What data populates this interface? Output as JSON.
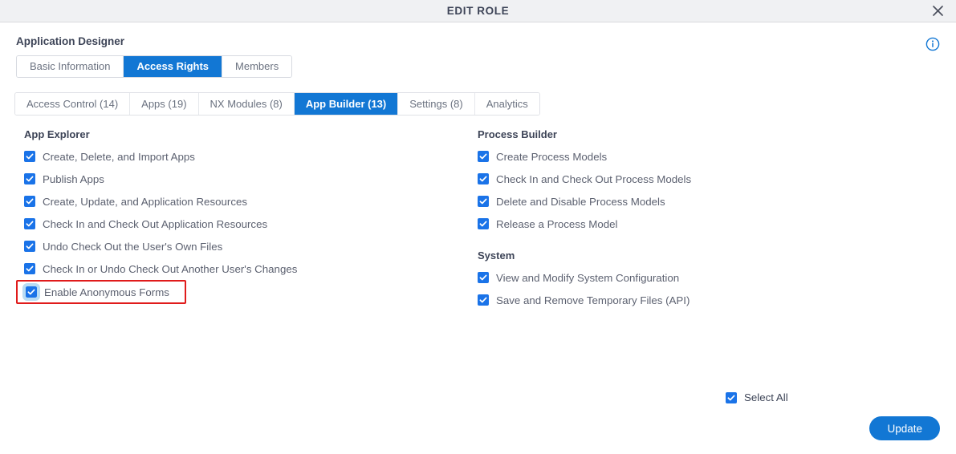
{
  "header": {
    "title": "EDIT ROLE",
    "close_icon": "close-icon"
  },
  "info": {
    "icon": "info-circle-icon"
  },
  "page_title": "Application Designer",
  "primary_tabs": [
    {
      "label": "Basic Information",
      "active": false
    },
    {
      "label": "Access Rights",
      "active": true
    },
    {
      "label": "Members",
      "active": false
    }
  ],
  "category_tabs": [
    {
      "label": "Access Control (14)",
      "active": false
    },
    {
      "label": "Apps (19)",
      "active": false
    },
    {
      "label": "NX Modules (8)",
      "active": false
    },
    {
      "label": "App Builder (13)",
      "active": true
    },
    {
      "label": "Settings (8)",
      "active": false
    },
    {
      "label": "Analytics",
      "active": false
    }
  ],
  "left_groups": [
    {
      "title": "App Explorer",
      "items": [
        {
          "label": "Create, Delete, and Import Apps",
          "checked": true,
          "highlighted": false,
          "focused": false
        },
        {
          "label": "Publish Apps",
          "checked": true,
          "highlighted": false,
          "focused": false
        },
        {
          "label": "Create, Update, and Application Resources",
          "checked": true,
          "highlighted": false,
          "focused": false
        },
        {
          "label": "Check In and Check Out Application Resources",
          "checked": true,
          "highlighted": false,
          "focused": false
        },
        {
          "label": "Undo Check Out the User's Own Files",
          "checked": true,
          "highlighted": false,
          "focused": false
        },
        {
          "label": "Check In or Undo Check Out Another User's Changes",
          "checked": true,
          "highlighted": false,
          "focused": false
        },
        {
          "label": "Enable Anonymous Forms",
          "checked": true,
          "highlighted": true,
          "focused": true
        }
      ]
    }
  ],
  "right_groups": [
    {
      "title": "Process Builder",
      "items": [
        {
          "label": "Create Process Models",
          "checked": true,
          "highlighted": false,
          "focused": false
        },
        {
          "label": "Check In and Check Out Process Models",
          "checked": true,
          "highlighted": false,
          "focused": false
        },
        {
          "label": "Delete and Disable Process Models",
          "checked": true,
          "highlighted": false,
          "focused": false
        },
        {
          "label": "Release a Process Model",
          "checked": true,
          "highlighted": false,
          "focused": false
        }
      ]
    },
    {
      "title": "System",
      "items": [
        {
          "label": "View and Modify System Configuration",
          "checked": true,
          "highlighted": false,
          "focused": false
        },
        {
          "label": "Save and Remove Temporary Files (API)",
          "checked": true,
          "highlighted": false,
          "focused": false
        }
      ]
    }
  ],
  "footer": {
    "select_all_label": "Select All",
    "select_all_checked": true,
    "update_label": "Update"
  },
  "colors": {
    "accent": "#1277d4",
    "checkbox": "#1a73e8",
    "highlight": "#e01b1b",
    "focus_ring": "#b9dcf3",
    "header_bg": "#f0f1f3",
    "text": "#5c6170",
    "heading": "#3d4457"
  }
}
